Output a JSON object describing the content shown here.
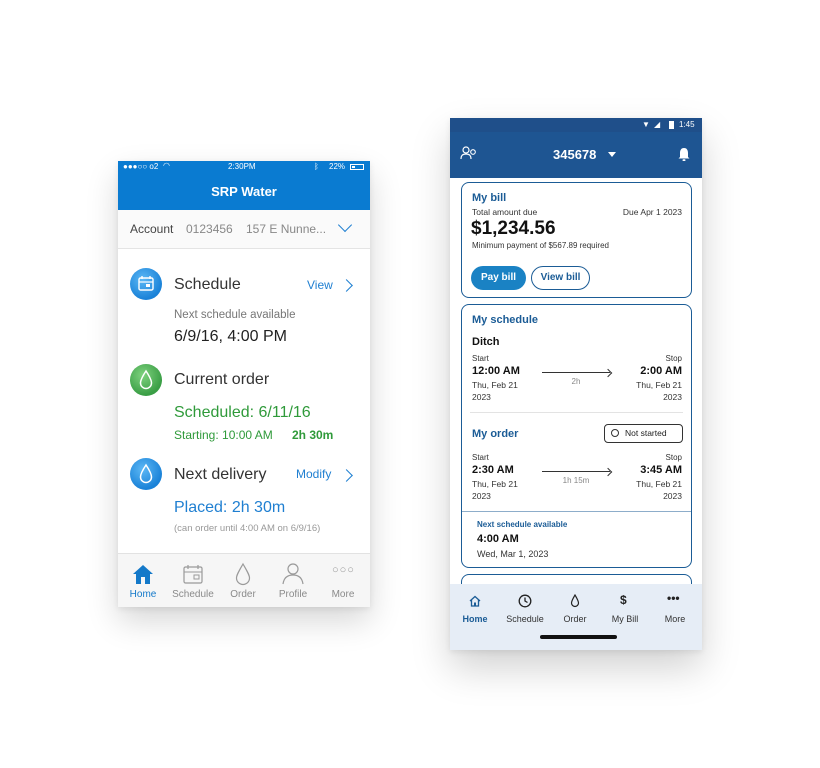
{
  "phone_a": {
    "status": {
      "carrier": "●●●○○ o2",
      "time": "2:30PM",
      "battery": "22%"
    },
    "title": "SRP Water",
    "account": {
      "label": "Account",
      "number": "0123456",
      "address": "157 E Nunne..."
    },
    "schedule": {
      "title": "Schedule",
      "action": "View",
      "subtitle": "Next schedule available",
      "datetime": "6/9/16, 4:00 PM"
    },
    "current_order": {
      "title": "Current order",
      "status": "Scheduled: 6/11/16",
      "starting": "Starting: 10:00 AM",
      "duration": "2h 30m"
    },
    "next_delivery": {
      "title": "Next delivery",
      "action": "Modify",
      "status": "Placed: 2h 30m",
      "note": "(can order until 4:00 AM on 6/9/16)"
    },
    "tabs": [
      "Home",
      "Schedule",
      "Order",
      "Profile",
      "More"
    ],
    "colors": {
      "primary": "#0a7bd1",
      "green": "#2f9a3a",
      "link": "#1f7fd1"
    }
  },
  "phone_b": {
    "status": {
      "time": "1:45"
    },
    "account_number": "345678",
    "bill": {
      "title": "My bill",
      "total_label": "Total amount due",
      "due": "Due Apr 1 2023",
      "amount": "$1,234.56",
      "minimum": "Minimum payment of $567.89 required",
      "pay_button": "Pay bill",
      "view_button": "View bill"
    },
    "schedule": {
      "title": "My schedule",
      "name": "Ditch",
      "start_label": "Start",
      "stop_label": "Stop",
      "start_time": "12:00 AM",
      "start_date": "Thu, Feb 21",
      "start_year": "2023",
      "stop_time": "2:00 AM",
      "stop_date": "Thu, Feb 21",
      "stop_year": "2023",
      "duration": "2h"
    },
    "order": {
      "title": "My order",
      "status": "Not started",
      "start_label": "Start",
      "stop_label": "Stop",
      "start_time": "2:30 AM",
      "start_date": "Thu, Feb 21",
      "start_year": "2023",
      "stop_time": "3:45 AM",
      "stop_date": "Thu, Feb 21",
      "stop_year": "2023",
      "duration": "1h 15m"
    },
    "next_schedule": {
      "label": "Next schedule available",
      "time": "4:00 AM",
      "date": "Wed, Mar 1, 2023"
    },
    "nav": [
      "Home",
      "Schedule",
      "Order",
      "My Bill",
      "More"
    ],
    "colors": {
      "primary": "#1e5592",
      "accent": "#1b5c96",
      "button": "#1a82c4"
    }
  }
}
